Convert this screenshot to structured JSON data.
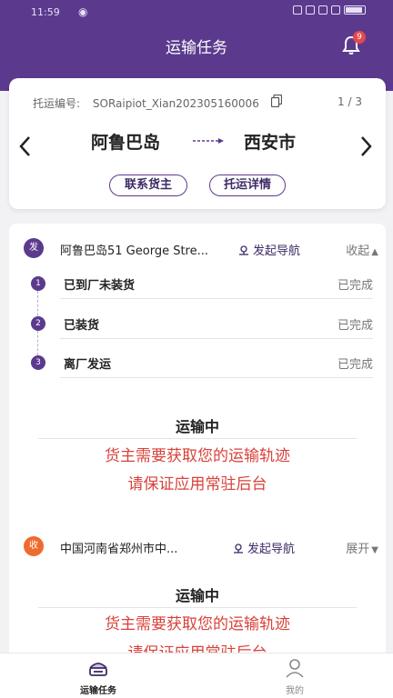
{
  "status_bar": {
    "time": "11:59"
  },
  "header": {
    "title": "运输任务",
    "notification_count": "9"
  },
  "shipment": {
    "number_label": "托运编号:",
    "number_value": "SORaipiot_Xian202305160006",
    "pager": "1 / 3",
    "origin": "阿鲁巴岛",
    "destination": "西安市",
    "contact_button": "联系货主",
    "detail_button": "托运详情"
  },
  "pickup": {
    "badge": "发",
    "address": "阿鲁巴岛51 George Stre...",
    "navigate": "发起导航",
    "toggle": "收起",
    "steps": [
      {
        "num": "1",
        "name": "已到厂未装货",
        "state": "已完成"
      },
      {
        "num": "2",
        "name": "已装货",
        "state": "已完成"
      },
      {
        "num": "3",
        "name": "离厂发运",
        "state": "已完成"
      }
    ]
  },
  "transit_1": {
    "title": "运输中",
    "line1": "货主需要获取您的运输轨迹",
    "line2": "请保证应用常驻后台"
  },
  "delivery": {
    "badge": "收",
    "address": "中国河南省郑州市中...",
    "navigate": "发起导航",
    "toggle": "展开"
  },
  "transit_2": {
    "title": "运输中",
    "line1": "货主需要获取您的运输轨迹",
    "line2": "请保证应用常驻后台"
  },
  "tabbar": {
    "tab1": "运输任务",
    "tab2": "我的"
  },
  "colors": {
    "brand": "#5b3a8e",
    "warning": "#d9413a",
    "delivery_badge": "#ee6b2f"
  }
}
